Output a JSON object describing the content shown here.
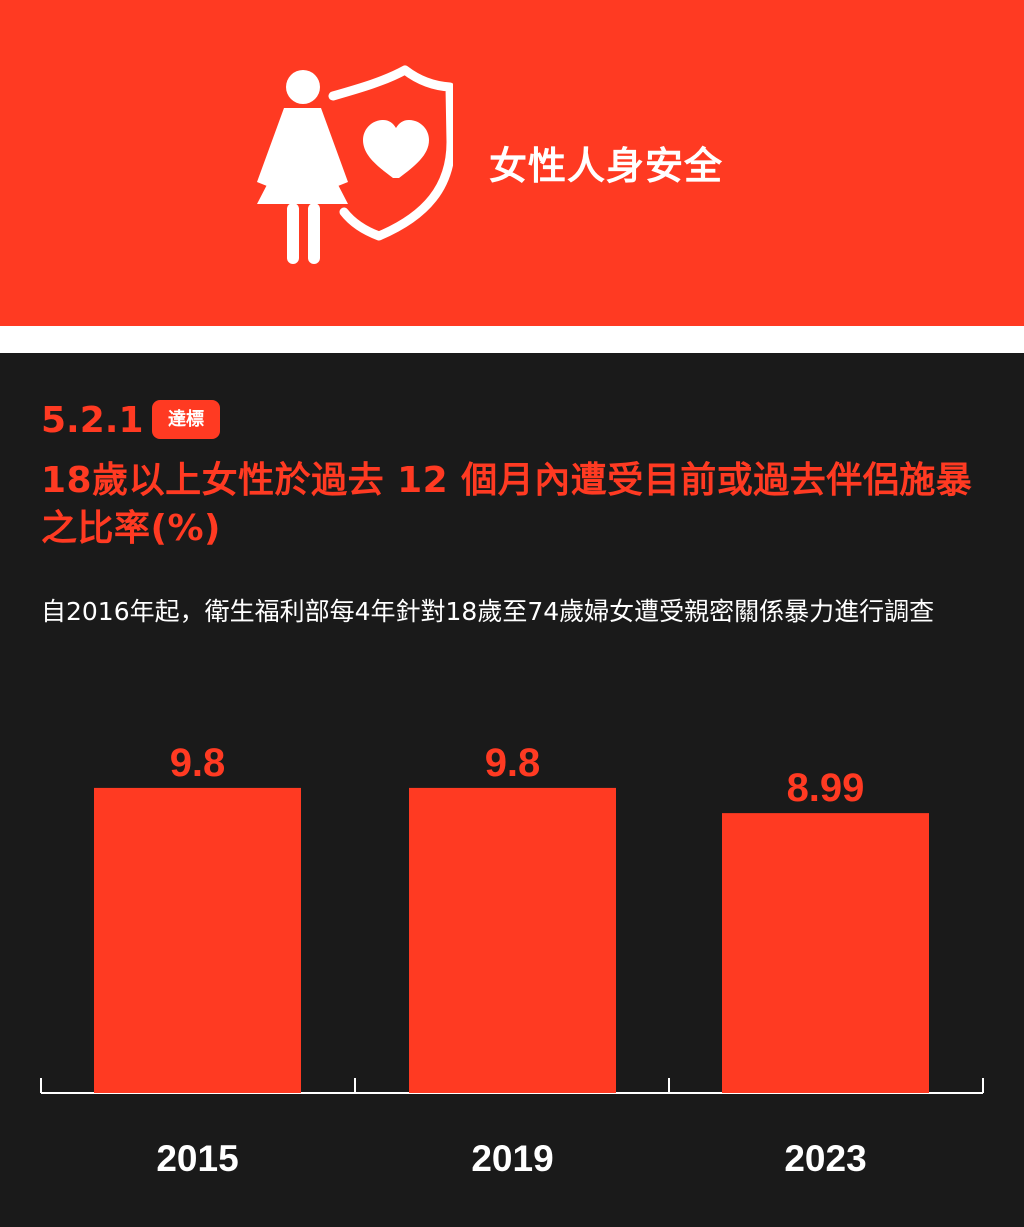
{
  "header": {
    "title": "女性人身安全",
    "icon": "woman-shield-heart-icon",
    "background_color": "#ff3a22"
  },
  "indicator": {
    "code": "5.2.1",
    "badge": "達標",
    "title": "18歲以上女性於過去 12 個月內遭受目前或過去伴侶施暴之比率(%)",
    "note": "自2016年起，衛生福利部每4年針對18歲至74歲婦女遭受親密關係暴力進行調查"
  },
  "colors": {
    "accent": "#ff3a22",
    "content_background": "#1a1a1a",
    "text": "#ffffff"
  },
  "chart_data": {
    "type": "bar",
    "categories": [
      "2015",
      "2019",
      "2023"
    ],
    "values": [
      9.8,
      9.8,
      8.99
    ],
    "value_labels": [
      "9.8",
      "9.8",
      "8.99"
    ],
    "title": "",
    "xlabel": "",
    "ylabel": "",
    "ylim": [
      0,
      10.6
    ],
    "grid": false,
    "legend": "none",
    "bar_color": "#ff3a22"
  }
}
